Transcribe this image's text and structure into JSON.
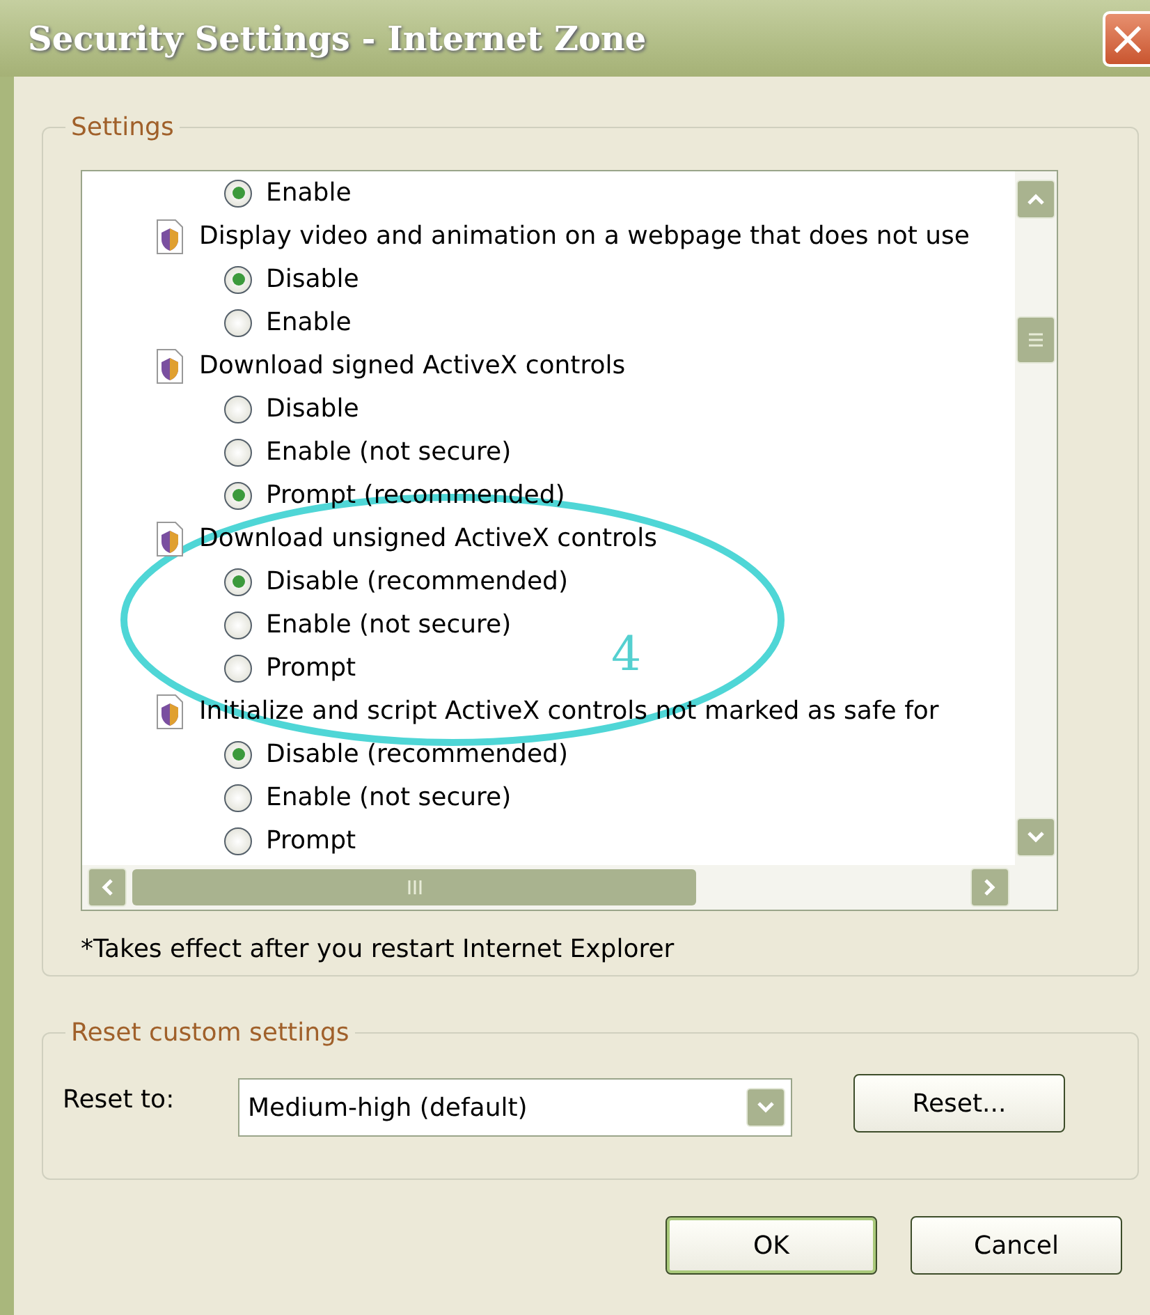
{
  "window": {
    "title": "Security Settings - Internet Zone",
    "close": "×"
  },
  "settings": {
    "legend": "Settings",
    "items": [
      {
        "kind": "option",
        "label": "Enable",
        "selected": true
      },
      {
        "kind": "category",
        "label": "Display video and animation on a webpage that does not use"
      },
      {
        "kind": "option",
        "label": "Disable",
        "selected": true
      },
      {
        "kind": "option",
        "label": "Enable",
        "selected": false
      },
      {
        "kind": "category",
        "label": "Download signed ActiveX controls"
      },
      {
        "kind": "option",
        "label": "Disable",
        "selected": false
      },
      {
        "kind": "option",
        "label": "Enable (not secure)",
        "selected": false
      },
      {
        "kind": "option",
        "label": "Prompt (recommended)",
        "selected": true
      },
      {
        "kind": "category",
        "label": "Download unsigned ActiveX controls"
      },
      {
        "kind": "option",
        "label": "Disable (recommended)",
        "selected": true
      },
      {
        "kind": "option",
        "label": "Enable (not secure)",
        "selected": false
      },
      {
        "kind": "option",
        "label": "Prompt",
        "selected": false
      },
      {
        "kind": "category",
        "label": "Initialize and script ActiveX controls not marked as safe for"
      },
      {
        "kind": "option",
        "label": "Disable (recommended)",
        "selected": true
      },
      {
        "kind": "option",
        "label": "Enable (not secure)",
        "selected": false
      },
      {
        "kind": "option",
        "label": "Prompt",
        "selected": false
      }
    ],
    "annotation": {
      "label": "4"
    },
    "note": "*Takes effect after you restart Internet Explorer"
  },
  "reset": {
    "legend": "Reset custom settings",
    "label": "Reset to:",
    "value": "Medium-high (default)",
    "button": "Reset..."
  },
  "buttons": [
    {
      "label": "OK",
      "default": true
    },
    {
      "label": "Cancel",
      "default": false
    }
  ]
}
